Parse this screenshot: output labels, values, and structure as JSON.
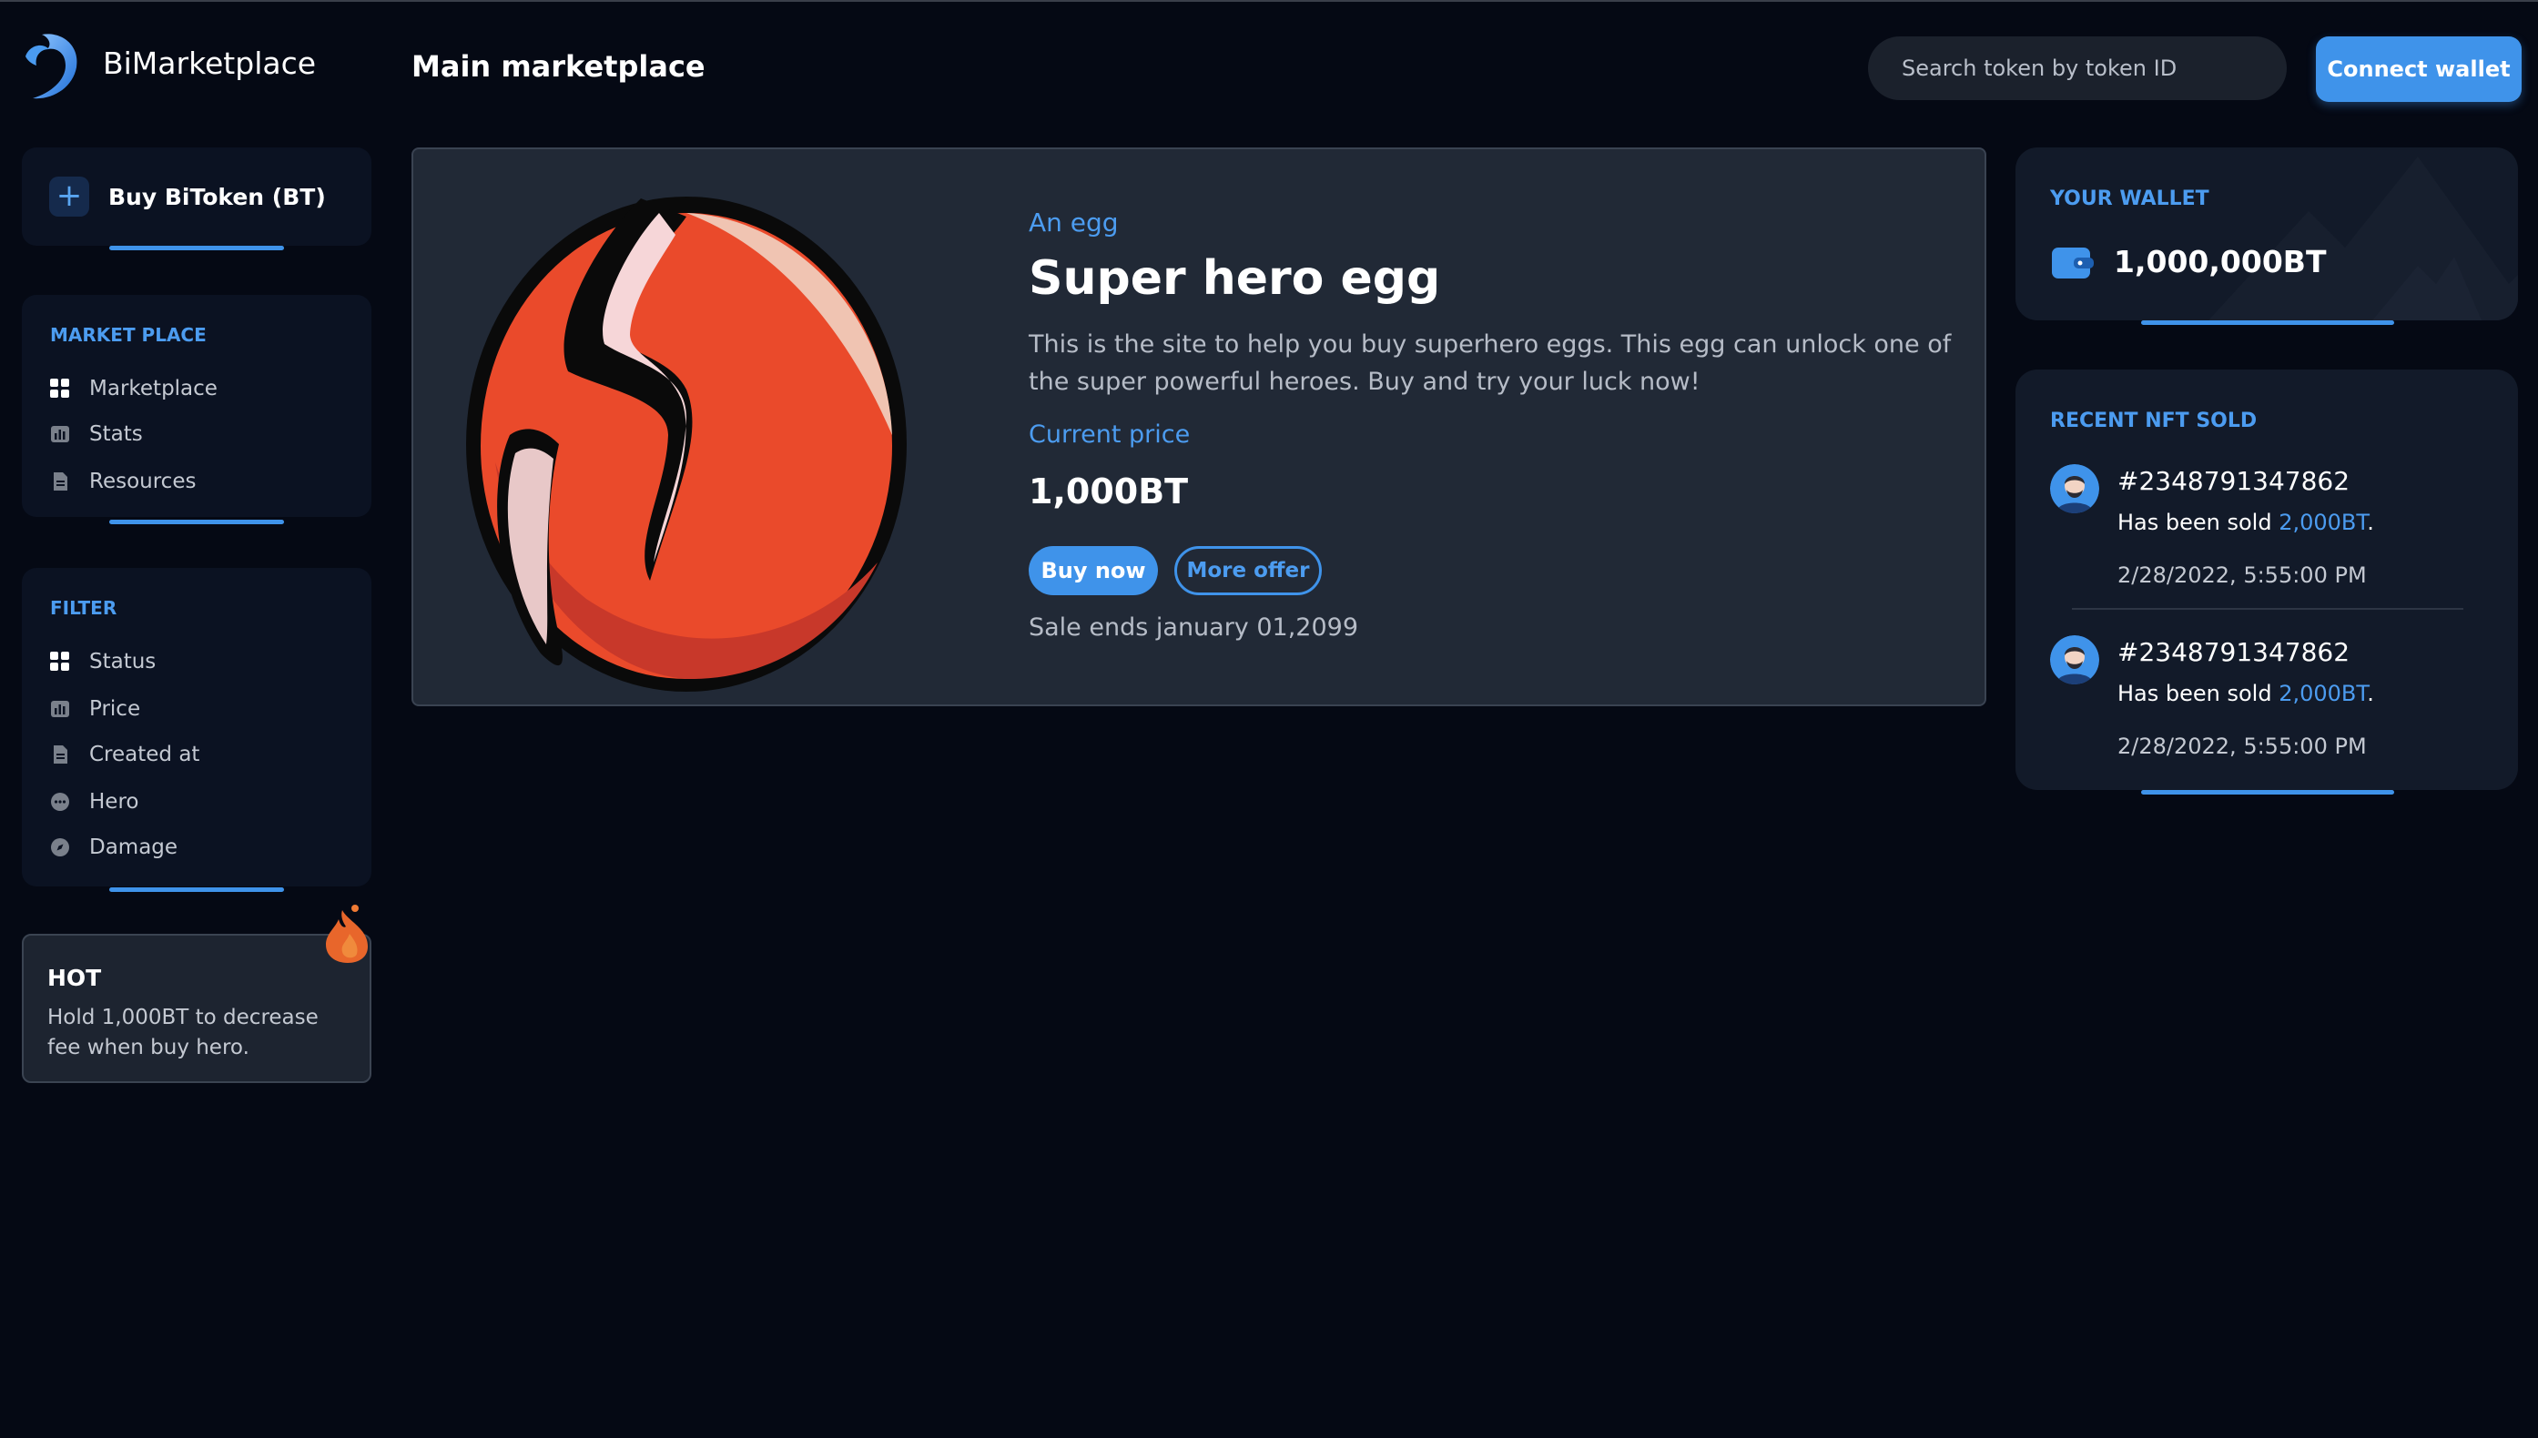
{
  "app": {
    "brand": "BiMarketplace",
    "page_title": "Main marketplace"
  },
  "header": {
    "search_placeholder": "Search token by token ID",
    "connect_label": "Connect wallet"
  },
  "sidebar": {
    "buy_label": "Buy BiToken (BT)",
    "marketplace_section": {
      "title": "MARKET PLACE",
      "items": [
        {
          "label": "Marketplace",
          "icon": "grid-icon"
        },
        {
          "label": "Stats",
          "icon": "chart-icon"
        },
        {
          "label": "Resources",
          "icon": "document-icon"
        }
      ]
    },
    "filter_section": {
      "title": "FILTER",
      "items": [
        {
          "label": "Status",
          "icon": "grid-icon"
        },
        {
          "label": "Price",
          "icon": "chart-icon"
        },
        {
          "label": "Created at",
          "icon": "document-icon"
        },
        {
          "label": "Hero",
          "icon": "chat-icon"
        },
        {
          "label": "Damage",
          "icon": "compass-icon"
        }
      ]
    },
    "hot": {
      "title": "HOT",
      "text": "Hold 1,000BT to decrease fee when buy hero."
    }
  },
  "featured": {
    "kicker": "An egg",
    "title": "Super hero egg",
    "description": "This is the site to help you buy superhero eggs. This egg can unlock one of the super powerful heroes. Buy and try your luck now!",
    "price_label": "Current price",
    "price": "1,000BT",
    "buy_label": "Buy now",
    "offer_label": "More offer",
    "sale_ends": "Sale ends january 01,2099"
  },
  "wallet": {
    "title": "YOUR WALLET",
    "balance": "1,000,000BT"
  },
  "recent": {
    "title": "RECENT NFT SOLD",
    "items": [
      {
        "id": "#2348791347862",
        "prefix": "Has been sold ",
        "amount": "2,000BT",
        "suffix": ".",
        "date": "2/28/2022, 5:55:00 PM"
      },
      {
        "id": "#2348791347862",
        "prefix": "Has been sold ",
        "amount": "2,000BT",
        "suffix": ".",
        "date": "2/28/2022, 5:55:00 PM"
      }
    ]
  },
  "colors": {
    "background": "#050914",
    "accent": "#3f93ea",
    "card": "#212936",
    "sidebar_card": "#0b1222",
    "egg_red": "#ea4a2b"
  }
}
